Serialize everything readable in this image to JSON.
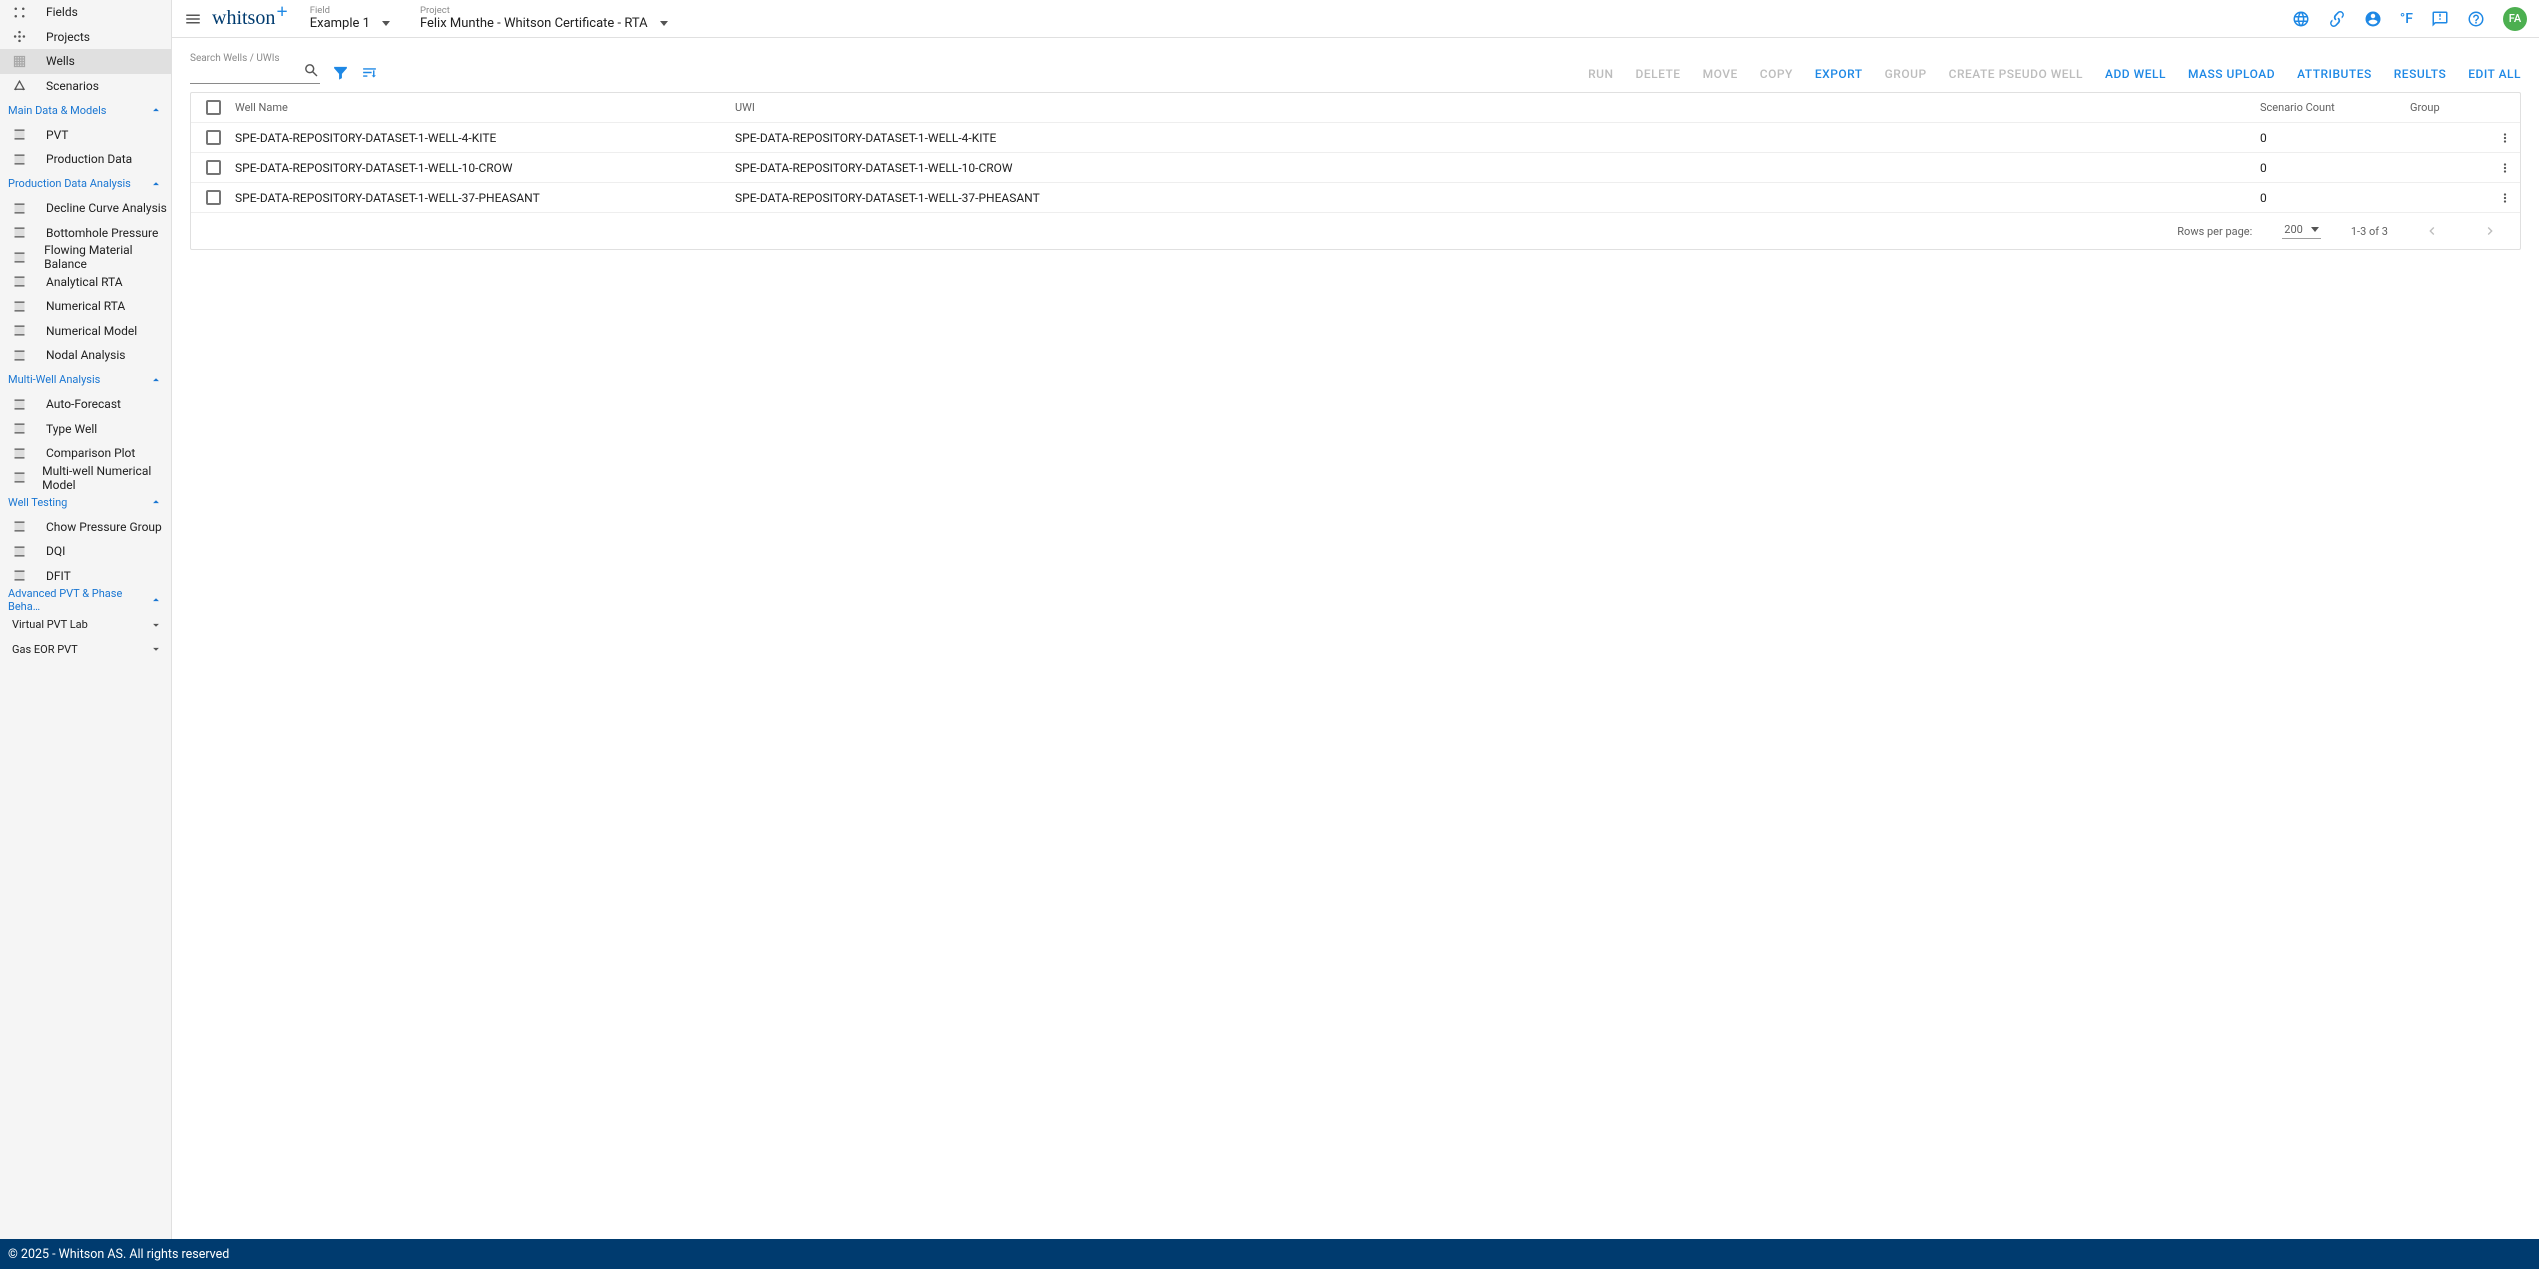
{
  "topbar": {
    "logo_text": "whitson",
    "logo_plus": "+",
    "field_label": "Field",
    "field_value": "Example 1",
    "project_label": "Project",
    "project_value": "Felix Munthe - Whitson Certificate - RTA",
    "unit_label": "°F",
    "avatar_initials": "FA"
  },
  "sidebar": {
    "top_items": [
      {
        "label": "Fields"
      },
      {
        "label": "Projects"
      },
      {
        "label": "Wells",
        "active": true
      },
      {
        "label": "Scenarios"
      }
    ],
    "groups": [
      {
        "title": "Main Data & Models",
        "items": [
          {
            "label": "PVT"
          },
          {
            "label": "Production Data"
          }
        ]
      },
      {
        "title": "Production Data Analysis",
        "items": [
          {
            "label": "Decline Curve Analysis"
          },
          {
            "label": "Bottomhole Pressure"
          },
          {
            "label": "Flowing Material Balance"
          },
          {
            "label": "Analytical RTA"
          },
          {
            "label": "Numerical RTA"
          },
          {
            "label": "Numerical Model"
          },
          {
            "label": "Nodal Analysis"
          }
        ]
      },
      {
        "title": "Multi-Well Analysis",
        "items": [
          {
            "label": "Auto-Forecast"
          },
          {
            "label": "Type Well"
          },
          {
            "label": "Comparison Plot"
          },
          {
            "label": "Multi-well Numerical Model"
          }
        ]
      },
      {
        "title": "Well Testing",
        "items": [
          {
            "label": "Chow Pressure Group"
          },
          {
            "label": "DQI"
          },
          {
            "label": "DFIT"
          }
        ]
      },
      {
        "title": "Advanced PVT & Phase Beha…",
        "subgroups": [
          {
            "label": "Virtual PVT Lab"
          },
          {
            "label": "Gas EOR PVT"
          }
        ]
      }
    ]
  },
  "toolbar": {
    "search_label": "Search Wells / UWIs",
    "search_value": "",
    "buttons": {
      "run": "RUN",
      "delete": "DELETE",
      "move": "MOVE",
      "copy": "COPY",
      "export": "EXPORT",
      "group": "GROUP",
      "create_pseudo_well": "CREATE PSEUDO WELL",
      "add_well": "ADD WELL",
      "mass_upload": "MASS UPLOAD",
      "attributes": "ATTRIBUTES",
      "results": "RESULTS",
      "edit_all": "EDIT ALL"
    }
  },
  "table": {
    "headers": {
      "well_name": "Well Name",
      "uwi": "UWI",
      "scenario_count": "Scenario Count",
      "group": "Group"
    },
    "rows": [
      {
        "well_name": "SPE-DATA-REPOSITORY-DATASET-1-WELL-4-KITE",
        "uwi": "SPE-DATA-REPOSITORY-DATASET-1-WELL-4-KITE",
        "scenario_count": "0",
        "group": ""
      },
      {
        "well_name": "SPE-DATA-REPOSITORY-DATASET-1-WELL-10-CROW",
        "uwi": "SPE-DATA-REPOSITORY-DATASET-1-WELL-10-CROW",
        "scenario_count": "0",
        "group": ""
      },
      {
        "well_name": "SPE-DATA-REPOSITORY-DATASET-1-WELL-37-PHEASANT",
        "uwi": "SPE-DATA-REPOSITORY-DATASET-1-WELL-37-PHEASANT",
        "scenario_count": "0",
        "group": ""
      }
    ],
    "pager": {
      "rows_per_page_label": "Rows per page:",
      "rows_per_page_value": "200",
      "range_text": "1-3 of 3"
    }
  },
  "footer": {
    "text": "© 2025 - Whitson AS. All rights reserved"
  }
}
